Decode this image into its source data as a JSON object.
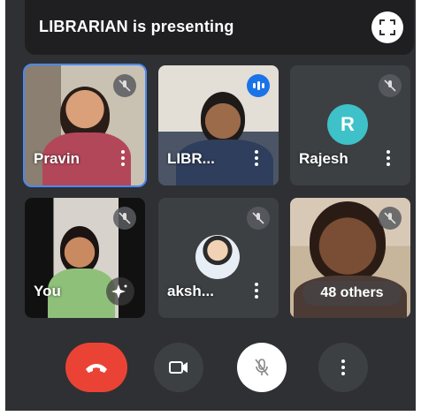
{
  "banner": {
    "text": "LIBRARIAN is presenting",
    "fullscreen_icon": "fullscreen-icon"
  },
  "tiles": [
    {
      "name": "Pravin",
      "state": "muted",
      "active": true
    },
    {
      "name": "LIBR...",
      "state": "speaking"
    },
    {
      "name": "Rajesh",
      "state": "muted",
      "avatar_letter": "R"
    },
    {
      "name": "You",
      "state": "muted"
    },
    {
      "name": "aksh...",
      "state": "muted"
    },
    {
      "name": "48 others",
      "state": "muted"
    }
  ],
  "controls": {
    "end_call_icon": "end-call-icon",
    "camera_icon": "camera-icon",
    "mic_icon": "mic-off-icon",
    "more_icon": "more-options-icon"
  },
  "colors": {
    "accent_blue": "#1a73e8",
    "end_call_red": "#ea4335",
    "avatar_teal": "#3ec1c8"
  }
}
